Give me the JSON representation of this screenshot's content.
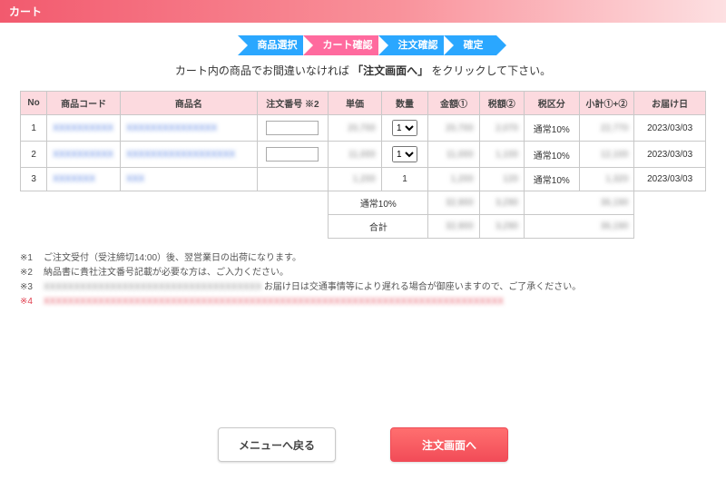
{
  "title": "カート",
  "steps": [
    "商品選択",
    "カート確認",
    "注文確認",
    "確定"
  ],
  "instruction_a": "カート内の商品でお間違いなければ",
  "instruction_b": "「注文画面へ」",
  "instruction_c": "をクリックして下さい。",
  "th": {
    "no": "No",
    "code": "商品コード",
    "name": "商品名",
    "orderno": "注文番号 ※2",
    "unit": "単価",
    "qty": "数量",
    "amount": "金額①",
    "tax": "税額②",
    "tax_kind": "税区分",
    "subtotal": "小計①+②",
    "deliver": "お届け日"
  },
  "rows": [
    {
      "no": "1",
      "code": "XXXXXXXXXX",
      "name": "XXXXXXXXXXXXXXX",
      "orderno": "",
      "unit": "20,700",
      "qty": "1",
      "amount": "20,700",
      "tax": "2,070",
      "tax_kind": "通常10%",
      "subtotal": "22,770",
      "deliver": "2023/03/03",
      "has_qty_select": true,
      "has_ordno_input": true
    },
    {
      "no": "2",
      "code": "XXXXXXXXXX",
      "name": "XXXXXXXXXXXXXXXXXX",
      "orderno": "",
      "unit": "11,000",
      "qty": "1",
      "amount": "11,000",
      "tax": "1,100",
      "tax_kind": "通常10%",
      "subtotal": "12,100",
      "deliver": "2023/03/03",
      "has_qty_select": true,
      "has_ordno_input": true
    },
    {
      "no": "3",
      "code": "XXXXXXX",
      "name": "XXX",
      "orderno": "",
      "unit": "1,200",
      "qty": "1",
      "amount": "1,200",
      "tax": "120",
      "tax_kind": "通常10%",
      "subtotal": "1,320",
      "deliver": "2023/03/03",
      "has_qty_select": false,
      "has_ordno_input": false
    }
  ],
  "summary": {
    "tax_label": "通常10%",
    "tax_amount": "32,900",
    "tax_tax": "3,290",
    "tax_subtotal": "36,190",
    "total_label": "合計",
    "total_amount": "32,900",
    "total_tax": "3,290",
    "total_subtotal": "36,190"
  },
  "notes": {
    "n1_idx": "※1",
    "n1": "ご注文受付（受注締切14:00）後、翌営業日の出荷になります。",
    "n2_idx": "※2",
    "n2": "納品書に貴社注文番号記載が必要な方は、ご入力ください。",
    "n3_idx": "※3",
    "n3a": "XXXXXXXXXXXXXXXXXXXXXXXXXXXXXXXXXXXX",
    "n3b": "お届け日は交通事情等により遅れる場合が御座いますので、ご了承ください。",
    "n4_idx": "※4",
    "n4": "XXXXXXXXXXXXXXXXXXXXXXXXXXXXXXXXXXXXXXXXXXXXXXXXXXXXXXXXXXXXXXXXXXXXXXXXXXXX"
  },
  "buttons": {
    "back": "メニューへ戻る",
    "next": "注文画面へ"
  }
}
